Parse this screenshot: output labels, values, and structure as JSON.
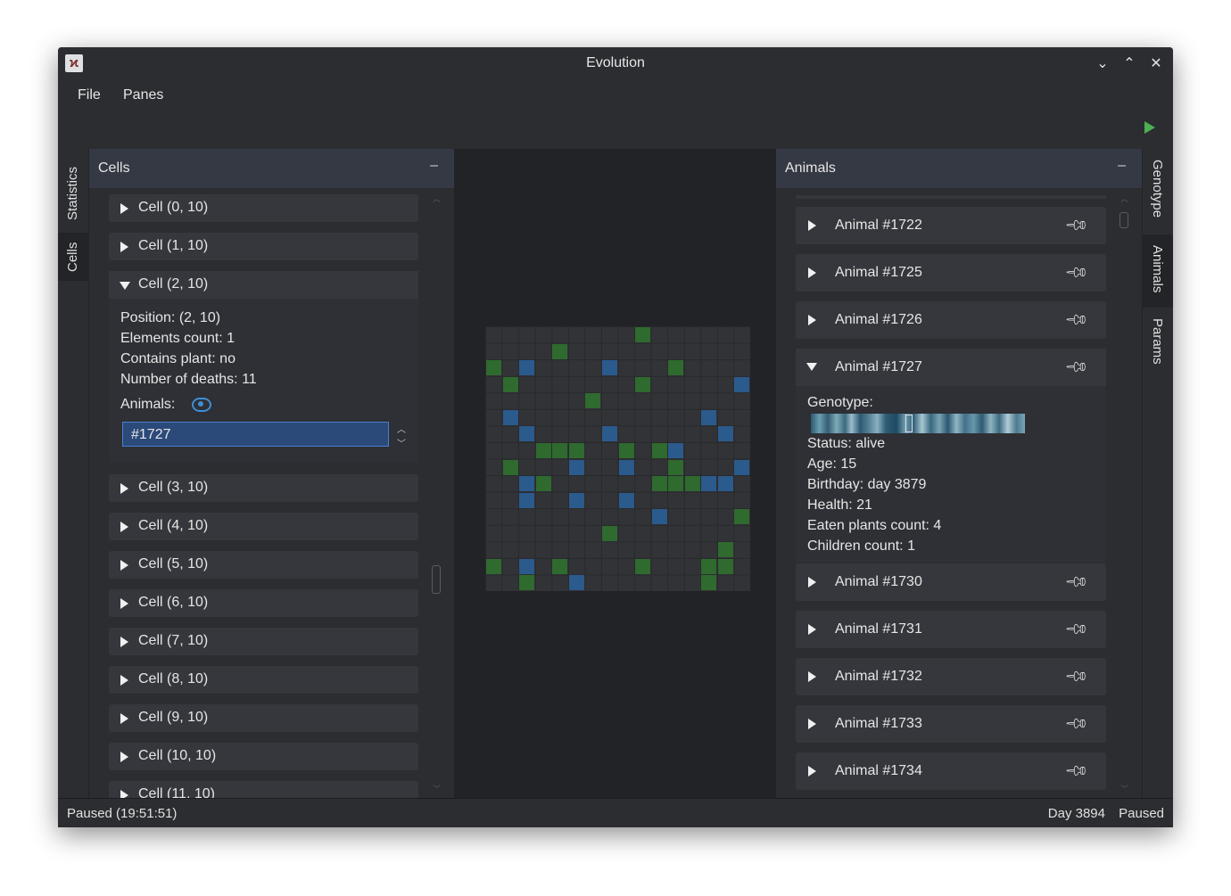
{
  "window": {
    "title": "Evolution"
  },
  "menu": {
    "file": "File",
    "panes": "Panes"
  },
  "left_tabs": {
    "statistics": "Statistics",
    "cells": "Cells"
  },
  "right_tabs": {
    "genotype": "Genotype",
    "animals": "Animals",
    "params": "Params"
  },
  "cells_panel": {
    "title": "Cells",
    "minimize": "–",
    "items": [
      "Cell (0, 10)",
      "Cell (1, 10)",
      "Cell (2, 10)",
      "Cell (3, 10)",
      "Cell (4, 10)",
      "Cell (5, 10)",
      "Cell (6, 10)",
      "Cell (7, 10)",
      "Cell (8, 10)",
      "Cell (9, 10)",
      "Cell (10, 10)",
      "Cell (11, 10)"
    ],
    "expanded": {
      "position": "Position: (2, 10)",
      "elements": "Elements count: 1",
      "plant": "Contains plant: no",
      "deaths": "Number of deaths: 11",
      "animals_label": "Animals:",
      "animal_value": "#1727"
    }
  },
  "animals_panel": {
    "title": "Animals",
    "minimize": "–",
    "items": [
      "Animal #1722",
      "Animal #1725",
      "Animal #1726",
      "Animal #1727",
      "Animal #1730",
      "Animal #1731",
      "Animal #1732",
      "Animal #1733",
      "Animal #1734"
    ],
    "expanded": {
      "genotype_label": "Genotype:",
      "status": "Status: alive",
      "age": "Age: 15",
      "birthday": "Birthday: day 3879",
      "health": "Health: 21",
      "eaten": "Eaten plants count: 4",
      "children": "Children count: 1"
    }
  },
  "world_grid": {
    "size": 16,
    "plants": [
      [
        9,
        0
      ],
      [
        4,
        1
      ],
      [
        0,
        2
      ],
      [
        11,
        2
      ],
      [
        1,
        3
      ],
      [
        9,
        3
      ],
      [
        6,
        4
      ],
      [
        3,
        7
      ],
      [
        4,
        7
      ],
      [
        5,
        7
      ],
      [
        8,
        7
      ],
      [
        10,
        7
      ],
      [
        1,
        8
      ],
      [
        11,
        8
      ],
      [
        3,
        9
      ],
      [
        10,
        9
      ],
      [
        11,
        9
      ],
      [
        12,
        9
      ],
      [
        15,
        11
      ],
      [
        7,
        12
      ],
      [
        14,
        13
      ],
      [
        0,
        14
      ],
      [
        4,
        14
      ],
      [
        9,
        14
      ],
      [
        13,
        14
      ],
      [
        14,
        14
      ],
      [
        2,
        15
      ],
      [
        13,
        15
      ]
    ],
    "animals": [
      [
        2,
        2
      ],
      [
        7,
        2
      ],
      [
        15,
        3
      ],
      [
        1,
        5
      ],
      [
        13,
        5
      ],
      [
        2,
        6
      ],
      [
        7,
        6
      ],
      [
        14,
        6
      ],
      [
        11,
        7
      ],
      [
        5,
        8
      ],
      [
        8,
        8
      ],
      [
        15,
        8
      ],
      [
        2,
        9
      ],
      [
        13,
        9
      ],
      [
        14,
        9
      ],
      [
        2,
        10
      ],
      [
        5,
        10
      ],
      [
        8,
        10
      ],
      [
        10,
        11
      ],
      [
        2,
        14
      ],
      [
        5,
        15
      ]
    ]
  },
  "status": {
    "left": "Paused (19:51:51)",
    "day": "Day 3894",
    "right": "Paused"
  },
  "colors": {
    "plant": "#2f6a2f",
    "animal": "#2b5a8c",
    "accent": "#3d8fd8",
    "play": "#4caf50"
  }
}
